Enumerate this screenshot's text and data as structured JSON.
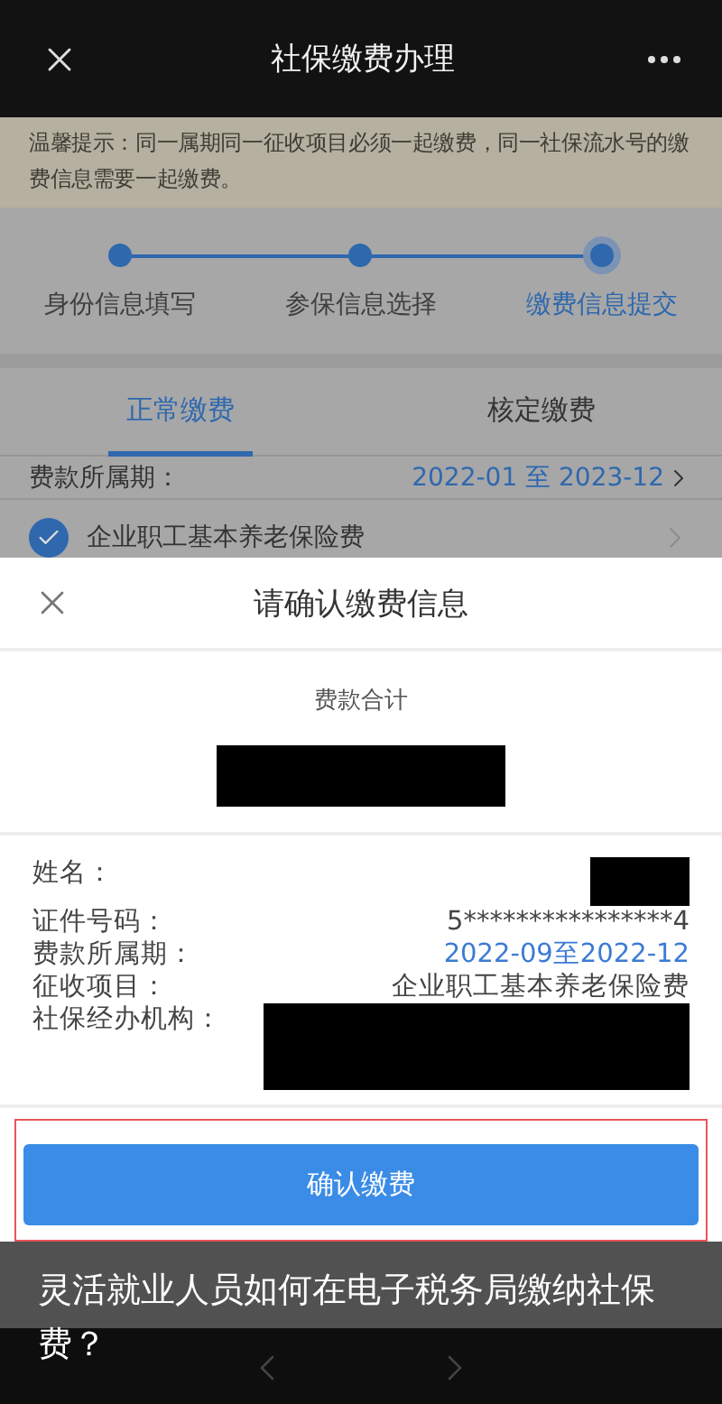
{
  "header": {
    "title": "社保缴费办理"
  },
  "notice": "温馨提示：同一属期同一征收项目必须一起缴费，同一社保流水号的缴费信息需要一起缴费。",
  "steps": [
    {
      "label": "身份信息填写",
      "selected": false
    },
    {
      "label": "参保信息选择",
      "selected": false
    },
    {
      "label": "缴费信息提交",
      "selected": true
    }
  ],
  "tabs": [
    {
      "label": "正常缴费",
      "selected": true
    },
    {
      "label": "核定缴费",
      "selected": false
    }
  ],
  "period": {
    "label": "费款所属期：",
    "value": "2022-01 至 2023-12"
  },
  "item": {
    "label": "企业职工基本养老保险费",
    "checked": true
  },
  "modal": {
    "title": "请确认缴费信息",
    "total_label": "费款合计",
    "fields": [
      {
        "label": "姓名：",
        "kind": "redacted"
      },
      {
        "label": "证件号码：",
        "kind": "text",
        "value": "5****************4"
      },
      {
        "label": "费款所属期：",
        "kind": "link",
        "value": "2022-09至2022-12"
      },
      {
        "label": "征收项目：",
        "kind": "text",
        "value": "企业职工基本养老保险费"
      },
      {
        "label": "社保经办机构：",
        "kind": "redacted_block"
      }
    ],
    "button": "确认缴费"
  },
  "caption": "灵活就业人员如何在电子税务局缴纳社保费？"
}
